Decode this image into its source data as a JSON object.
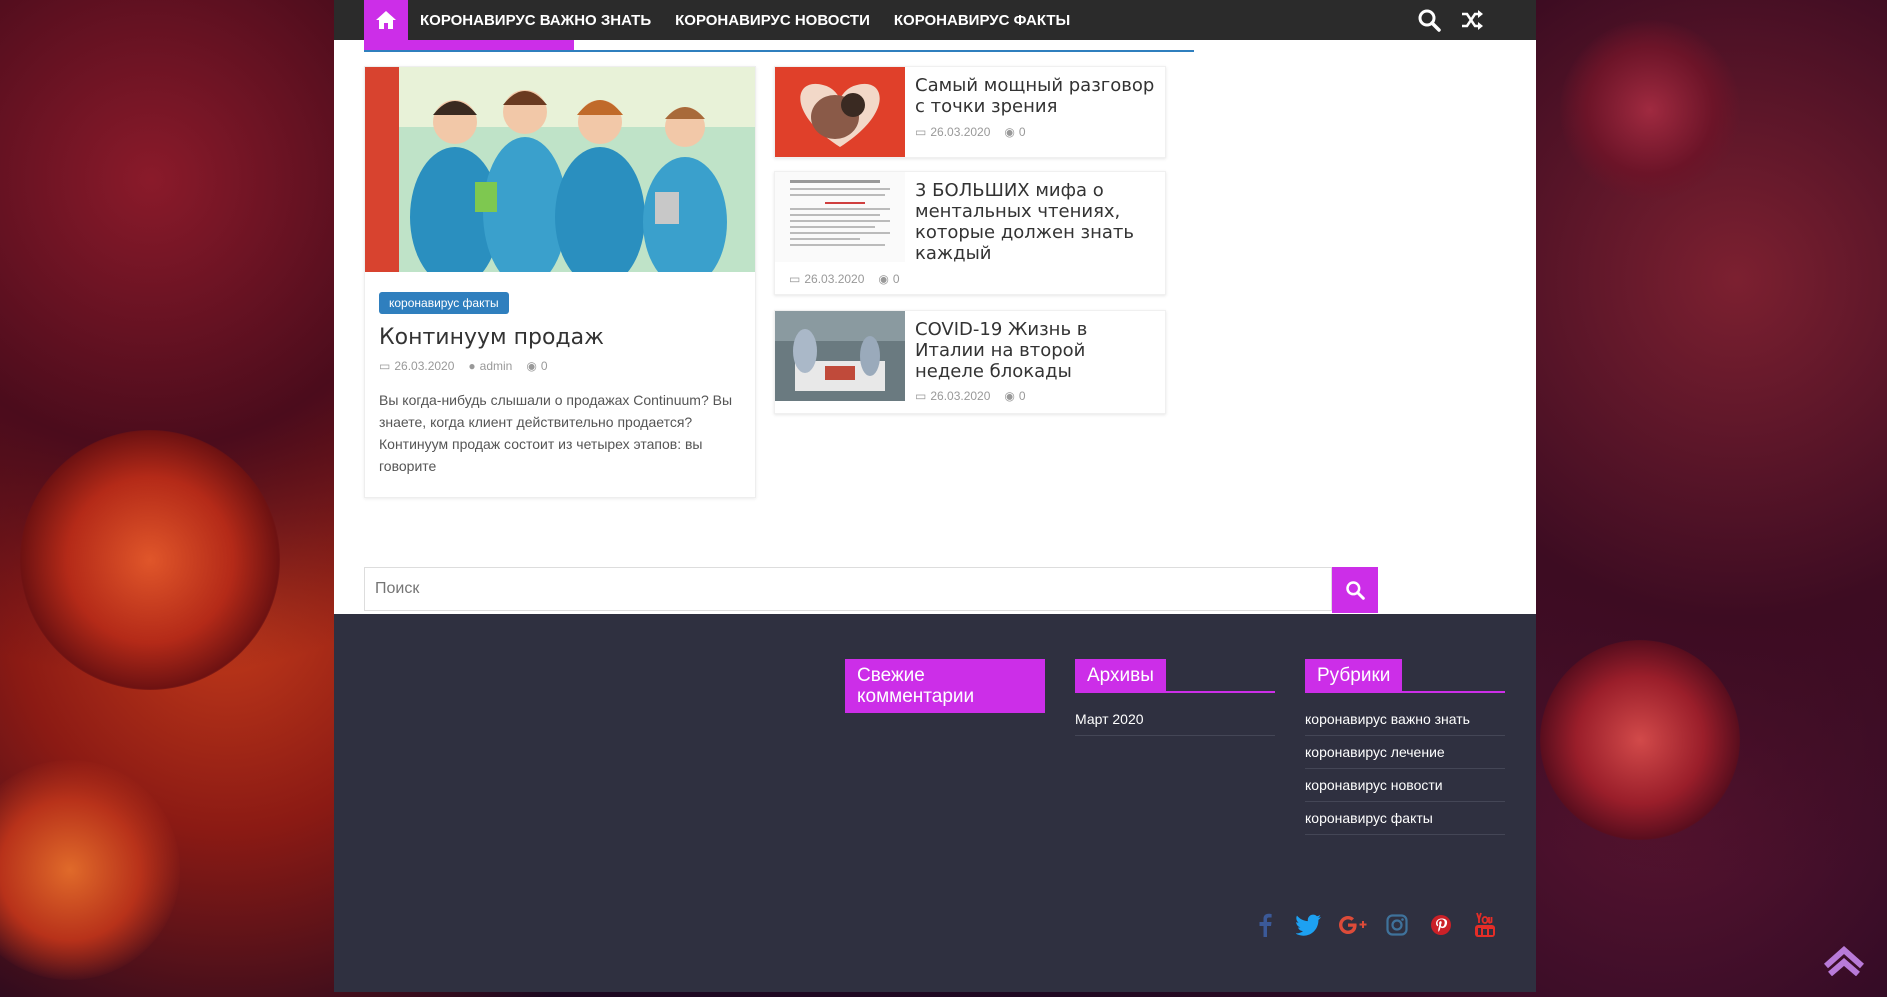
{
  "nav": {
    "items": [
      "КОРОНАВИРУС ВАЖНО ЗНАТЬ",
      "КОРОНАВИРУС НОВОСТИ",
      "КОРОНАВИРУС ФАКТЫ"
    ]
  },
  "featured": {
    "category": "коронавирус факты",
    "title": "Континуум продаж",
    "date": "26.03.2020",
    "author": "admin",
    "comments": "0",
    "excerpt": "Вы когда-нибудь слышали о продажах Continuum? Вы знаете, когда клиент действительно продается? Континуум продаж состоит из четырех этапов: вы говорите"
  },
  "side_posts": [
    {
      "title": "Самый мощный разговор с точки зрения",
      "date": "26.03.2020",
      "comments": "0"
    },
    {
      "title": "3 БОЛЬШИХ мифа о ментальных чтениях, которые должен знать каждый",
      "date": "26.03.2020",
      "comments": "0"
    },
    {
      "title": "COVID-19 Жизнь в Италии на второй неделе блокады",
      "date": "26.03.2020",
      "comments": "0"
    }
  ],
  "search": {
    "placeholder": "Поиск"
  },
  "footer": {
    "recent_comments_title": "Свежие комментарии",
    "archives_title": "Архивы",
    "archives": [
      "Март 2020"
    ],
    "categories_title": "Рубрики",
    "categories": [
      "коронавирус важно знать",
      "коронавирус лечение",
      "коронавирус новости",
      "коронавирус факты"
    ]
  },
  "social_icons": [
    "facebook-icon",
    "twitter-icon",
    "google-plus-icon",
    "instagram-icon",
    "pinterest-icon",
    "youtube-icon"
  ],
  "colors": {
    "accent": "#cc2ee8",
    "category_badge": "#2f7fbe",
    "topbar": "#2b2b2b",
    "footer": "#2f3040"
  }
}
